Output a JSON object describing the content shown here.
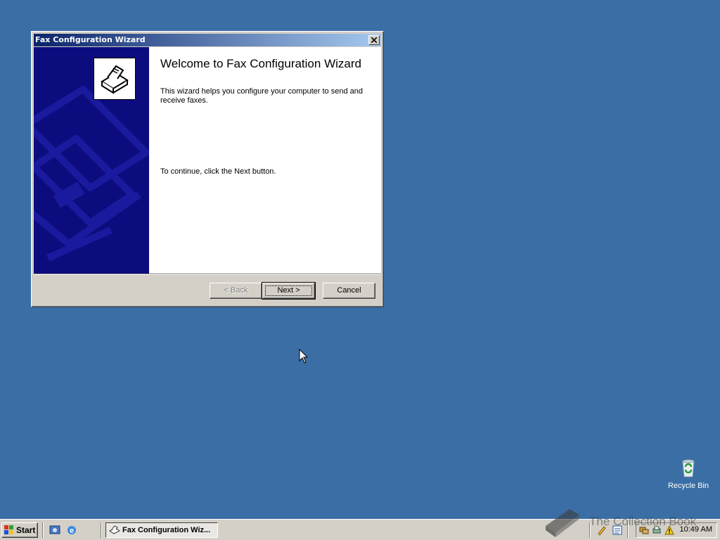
{
  "window": {
    "title": "Fax Configuration Wizard",
    "heading": "Welcome to Fax Configuration Wizard",
    "description": "This wizard helps you configure your computer to send and receive faxes.",
    "continue_text": "To continue, click the Next button.",
    "buttons": {
      "back": "< Back",
      "next": "Next >",
      "cancel": "Cancel"
    }
  },
  "desktop": {
    "recycle_bin_label": "Recycle Bin",
    "watermark": "The Collection Book",
    "background_color": "#3a6ea5"
  },
  "taskbar": {
    "start_label": "Start",
    "task_label": "Fax Configuration Wiz...",
    "clock": "10:49 AM"
  },
  "colors": {
    "titlebar_start": "#0a246a",
    "titlebar_end": "#a6caf0",
    "side_panel": "#0c0c7e",
    "chrome": "#d4d0c8"
  }
}
